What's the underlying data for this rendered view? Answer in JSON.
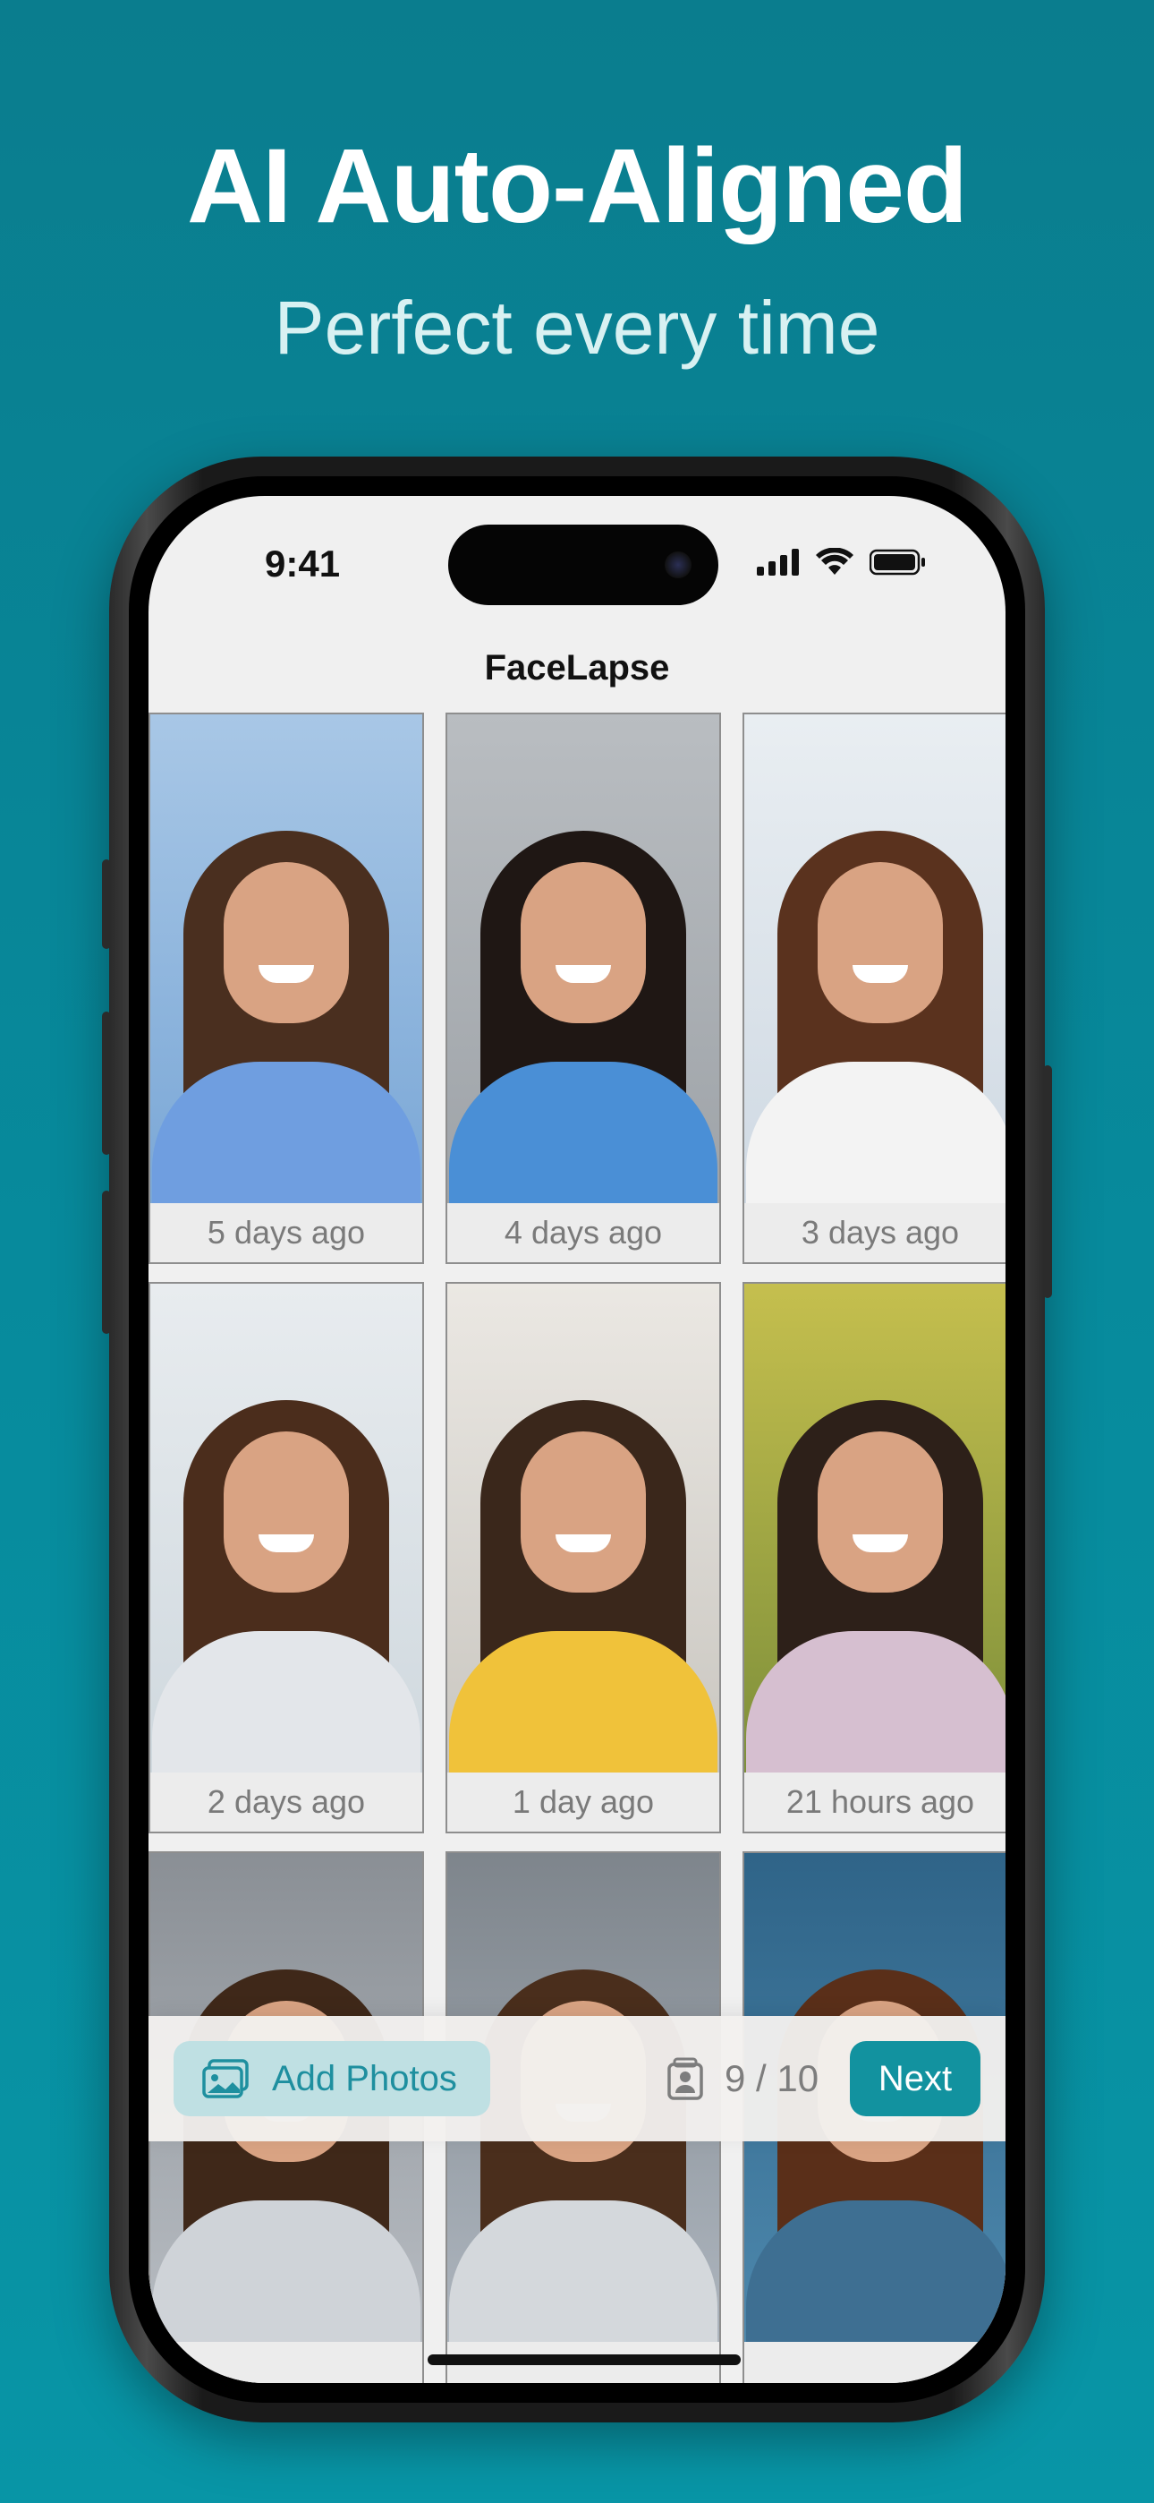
{
  "hero": {
    "title": "AI Auto-Aligned",
    "subtitle": "Perfect every time"
  },
  "status_bar": {
    "time": "9:41",
    "icons": [
      "signal-icon",
      "wifi-icon",
      "battery-icon"
    ]
  },
  "app": {
    "title": "FaceLapse"
  },
  "photos": [
    {
      "caption": "5 days ago",
      "bg": "#7aa7d6",
      "top": "#a8c7e6",
      "hair": "#4a2f1f",
      "body": "#6f9ee0"
    },
    {
      "caption": "4 days ago",
      "bg": "#9ea3a8",
      "top": "#b9bdc1",
      "hair": "#1f1714",
      "body": "#4a8fd6"
    },
    {
      "caption": "3 days ago",
      "bg": "#cfd9e3",
      "top": "#e9eef2",
      "hair": "#5a321e",
      "body": "#f3f3f3"
    },
    {
      "caption": "2 days ago",
      "bg": "#cfd8de",
      "top": "#e8ecef",
      "hair": "#4b2d1c",
      "body": "#e3e6ea"
    },
    {
      "caption": "1 day ago",
      "bg": "#c9c6c0",
      "top": "#ebe8e3",
      "hair": "#3a271b",
      "body": "#f0c23a"
    },
    {
      "caption": "21 hours ago",
      "bg": "#7d8f3a",
      "top": "#c5bf4e",
      "hair": "#2d2019",
      "body": "#d6bfd0"
    },
    {
      "caption": "",
      "bg": "#b8bdc3",
      "top": "#8a8f95",
      "hair": "#3f2819",
      "body": "#cfd3d8"
    },
    {
      "caption": "",
      "bg": "#aeb6bf",
      "top": "#7e858c",
      "hair": "#4a2e1c",
      "body": "#d4d8dc"
    },
    {
      "caption": "",
      "bg": "#4d88ad",
      "top": "#2f6488",
      "hair": "#5a2f19",
      "body": "#3e6f92"
    }
  ],
  "toolbar": {
    "add_photos_label": "Add Photos",
    "counter_label": "9 / 10",
    "next_label": "Next"
  },
  "colors": {
    "accent": "#12929f",
    "background": "#0a7d8e"
  }
}
